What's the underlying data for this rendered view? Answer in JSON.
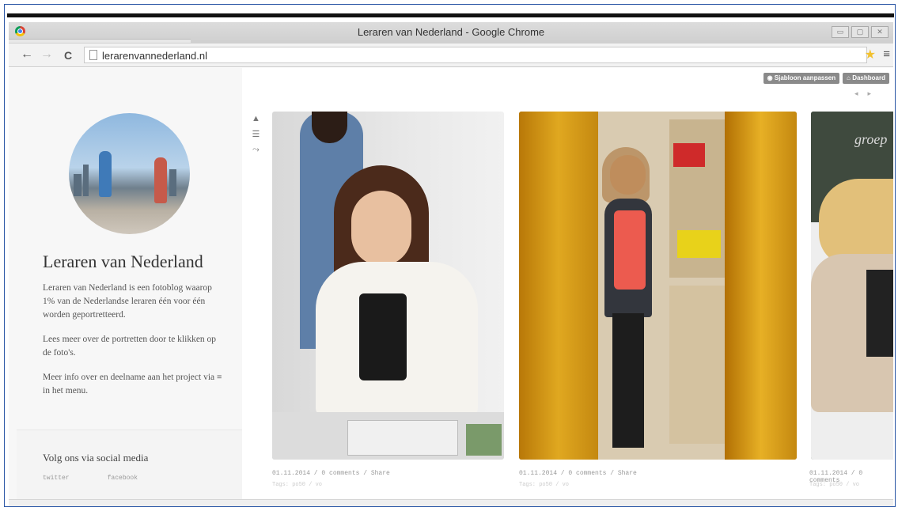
{
  "browser": {
    "window_title": "Leraren van Nederland - Google Chrome",
    "url": "lerarenvannederland.nl",
    "back_icon": "←",
    "forward_icon": "→",
    "reload_icon": "C",
    "star_icon": "★",
    "menu_icon": "≡",
    "window_buttons": [
      "▭",
      "▢",
      "✕"
    ]
  },
  "admin": {
    "template_button": "Sjabloon aanpassen",
    "dashboard_button": "Dashboard",
    "prev_arrow": "◂",
    "next_arrow": "▸"
  },
  "sidebar": {
    "title": "Leraren van Nederland",
    "paragraphs": [
      "Leraren van Nederland is een fotoblog waarop 1% van de Nederlandse leraren één voor één worden geportretteerd.",
      "Lees meer over de portretten door te klikken op de foto's.",
      "Meer info over en deelname aan het project via ≡ in het menu."
    ],
    "social_title": "Volg ons via social media",
    "social_links": [
      "twitter",
      "facebook"
    ]
  },
  "tools": [
    "person-icon",
    "list-icon",
    "link-icon"
  ],
  "posts": [
    {
      "meta": "01.11.2014 / 0 comments / Share",
      "tags": "Tags: po50 / vo"
    },
    {
      "meta": "01.11.2014 / 0 comments / Share",
      "tags": "Tags: po50 / vo"
    },
    {
      "meta": "01.11.2014 / 0 comments",
      "tags": "Tags: po50 / vo"
    }
  ],
  "colors": {
    "frame": "#2b57a6",
    "admin_button": "#8a8a8a",
    "sidebar_bg": "#f7f7f7"
  }
}
